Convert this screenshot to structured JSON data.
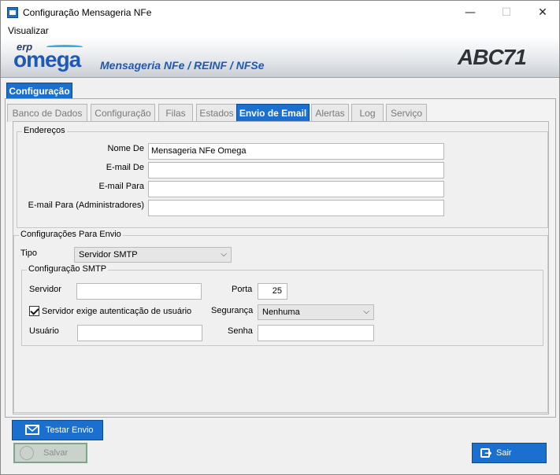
{
  "window": {
    "title": "Configuração Mensageria NFe",
    "minimize": "—",
    "maximize": "☐",
    "close": "✕"
  },
  "menu": {
    "items": [
      "Visualizar"
    ]
  },
  "banner": {
    "logo_erp": "erp",
    "logo_name": "omega",
    "subtitle": "Mensageria NFe / REINF / NFSe",
    "brand": "ABC71"
  },
  "main_tab": {
    "label": "Configuração"
  },
  "tabs": [
    {
      "label": "Banco de Dados",
      "active": false
    },
    {
      "label": "Configuração",
      "active": false
    },
    {
      "label": "Filas",
      "active": false
    },
    {
      "label": "Estados",
      "active": false
    },
    {
      "label": "Envio de Email",
      "active": true
    },
    {
      "label": "Alertas",
      "active": false
    },
    {
      "label": "Log",
      "active": false
    },
    {
      "label": "Serviço",
      "active": false
    }
  ],
  "enderecos": {
    "title": "Endereços",
    "nome_de_label": "Nome De",
    "nome_de_value": "Mensageria NFe Omega",
    "email_de_label": "E-mail De",
    "email_de_value": "",
    "email_para_label": "E-mail Para",
    "email_para_value": "",
    "email_admin_label": "E-mail Para (Administradores)",
    "email_admin_value": ""
  },
  "envio": {
    "title": "Configurações Para Envio",
    "tipo_label": "Tipo",
    "tipo_value": "Servidor SMTP",
    "smtp": {
      "title": "Configuração SMTP",
      "servidor_label": "Servidor",
      "servidor_value": "",
      "porta_label": "Porta",
      "porta_value": "25",
      "auth_label": "Servidor exige autenticação de usuário",
      "auth_checked": true,
      "seguranca_label": "Segurança",
      "seguranca_value": "Nenhuma",
      "usuario_label": "Usuário",
      "usuario_value": "",
      "senha_label": "Senha",
      "senha_value": ""
    }
  },
  "buttons": {
    "testar": "Testar Envio",
    "salvar": "Salvar",
    "sair": "Sair"
  },
  "colors": {
    "accent": "#1a6fcf",
    "brand_blue": "#1f58b5"
  }
}
